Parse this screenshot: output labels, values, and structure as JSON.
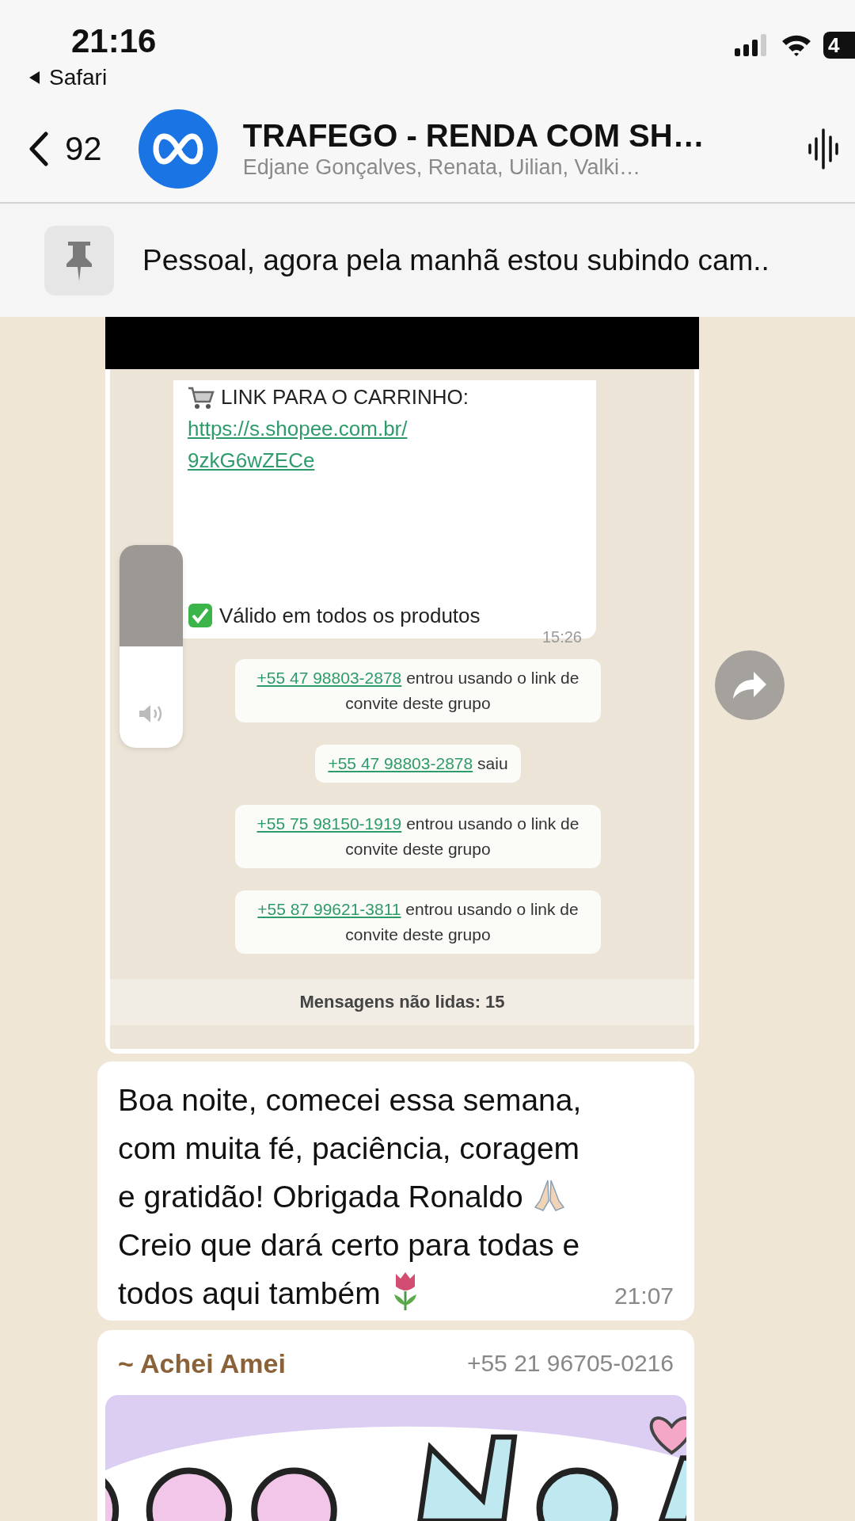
{
  "status_bar": {
    "time": "21:16",
    "back_app": "Safari",
    "battery": "4"
  },
  "header": {
    "back_count": "92",
    "title": "TRAFEGO - RENDA COM SH…",
    "subtitle": "Edjane Gonçalves, Renata, Uilian, Valki…"
  },
  "pinned": {
    "text": "Pessoal, agora pela manhã estou subindo cam.."
  },
  "image_message": {
    "screenshot": {
      "cart_line": "LINK PARA O CARRINHO:",
      "link_lines": [
        "https://s.shopee.com.br/",
        "9zkG6wZECe"
      ],
      "valid_line": "Válido em todos os produtos",
      "time": "15:26",
      "volume_hud": {
        "level": 0.5
      },
      "system_messages": [
        {
          "phone": "+55 47 98803-2878",
          "text": "entrou usando o link de convite deste grupo"
        },
        {
          "phone": "+55 47 98803-2878",
          "text": "saiu"
        },
        {
          "phone": "+55 75 98150-1919",
          "text": "entrou usando o link de convite deste grupo"
        },
        {
          "phone": "+55 87 99621-3811",
          "text": "entrou usando o link de convite deste grupo"
        }
      ],
      "unread_banner": "Mensagens não lidas: 15"
    }
  },
  "text_message": {
    "parts": [
      "Boa noite, comecei essa semana, com muita fé, paciência, coragem e gratidão! Obrigada Ronaldo",
      "Creio que dará certo para todas e todos aqui também"
    ],
    "time": "21:07"
  },
  "sticker_message": {
    "sender": "~ Achei Amei",
    "phone": "+55 21 96705-0216",
    "kind": "picture"
  }
}
